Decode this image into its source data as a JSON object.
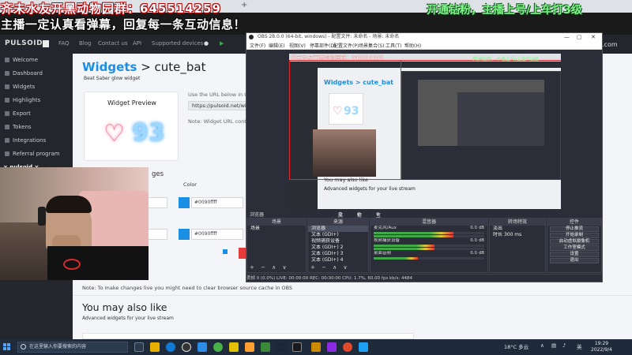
{
  "browser": {
    "tab_label": "",
    "new_tab": "+"
  },
  "overlay": {
    "top_left_line1": "齐未水友开黑动物园群：645514259",
    "top_left_line2": "主播一定认真看弹幕，回复每一条互动信息！",
    "top_right": "开通钻粉，主播上号/上车打3级"
  },
  "site": {
    "logo": "PULSOID",
    "nav": [
      "FAQ",
      "Blog",
      "Contact us",
      "API",
      "Supported devices"
    ],
    "nav_right": ".com",
    "sidebar": [
      "Welcome",
      "Dashboard",
      "Widgets",
      "Highlights",
      "Export",
      "Tokens",
      "Integrations",
      "Referral program"
    ],
    "sidebar_voice": "× pulsoid × VOICEMOD",
    "title_prefix": "Widgets",
    "title_sep": " > ",
    "title_name": "cute_bat",
    "subtitle": "Beat Saber glow widget",
    "preview_title": "Widget Preview",
    "preview_heart": "♡",
    "preview_bpm": "93",
    "use_url_text": "Use the URL below in OBS",
    "url_value": "https://pulsoid.net/wid",
    "note_url": "Note: Widget URL conta",
    "section_partial": "ges",
    "color_label": "Color",
    "size_label": "o",
    "hex1": "#0090ffff",
    "hex2": "#0090ffff",
    "note_cache": "Note: To make changes live you might need to clear browser source cache in OBS",
    "also_like_title": "You may also like",
    "also_like_sub": "Advanced widgets for your live stream"
  },
  "obs": {
    "title": "OBS 28.0.0 (64-bit, windows) - 配置文件: 未命名 - 场景: 未命名",
    "menu": [
      "文件(F)",
      "编辑(E)",
      "视图(V)",
      "停靠部件(D)",
      "配置文件(P)",
      "场景集合(S)",
      "工具(T)",
      "帮助(H)"
    ],
    "win_controls": [
      "—",
      "▢",
      "✕"
    ],
    "inner_title": "Widgets > cute_bat",
    "inner_heart": "♡",
    "inner_bpm": "93",
    "inner_also": "You may also like",
    "inner_hint": "Advanced widgets for your live stream",
    "inner_red": "齐未水友开黑动物园群：645514259",
    "inner_green": "开通钻粉，主播上号/上车打3级",
    "midbar": {
      "left": "浏览器",
      "props": "属性",
      "filters": "滤镜",
      "interact": "互动"
    },
    "scenes": {
      "header": "场景",
      "items": [
        "场景"
      ]
    },
    "sources": {
      "header": "来源",
      "items": [
        "浏览器",
        "文本 (GDI+)",
        "视频捕获设备",
        "文本 (GDI+) 2",
        "文本 (GDI+) 3",
        "文本 (GDI+) 4",
        "文本 (GDI+) 5"
      ]
    },
    "mixer": {
      "header": "混音器",
      "channels": [
        {
          "name": "麦克风/Aux",
          "db": "0.0 dB",
          "level": 0.72
        },
        {
          "name": "视频捕获设备",
          "db": "0.0 dB",
          "level": 0.55
        },
        {
          "name": "桌面音频",
          "db": "0.0 dB",
          "level": 0.4
        }
      ]
    },
    "transitions": {
      "header": "转场特效",
      "type": "淡出",
      "duration_label": "时长",
      "duration_value": "300 ms"
    },
    "controls": {
      "header": "控件",
      "buttons": [
        "停止推流",
        "开始录制",
        "启动虚拟摄像机",
        "工作室模式",
        "设置",
        "退出"
      ]
    },
    "footer_icons": "+ − ∧ ∨",
    "status": "丢帧 0 (0.0%)   LIVE: 00:00:00   REC: 00:00:00   CPU: 1.7%, 60.00 fps     kb/s: 4484"
  },
  "taskbar": {
    "search_placeholder": "在这里输入你要搜索的内容",
    "tray_weather": "18°C 多云",
    "tray_ime": "英",
    "time": "19:29",
    "date": "2022/9/4"
  },
  "colors": {
    "accent": "#1a8fe3",
    "red": "#e5262a",
    "obs_bg": "#2b2e38"
  }
}
